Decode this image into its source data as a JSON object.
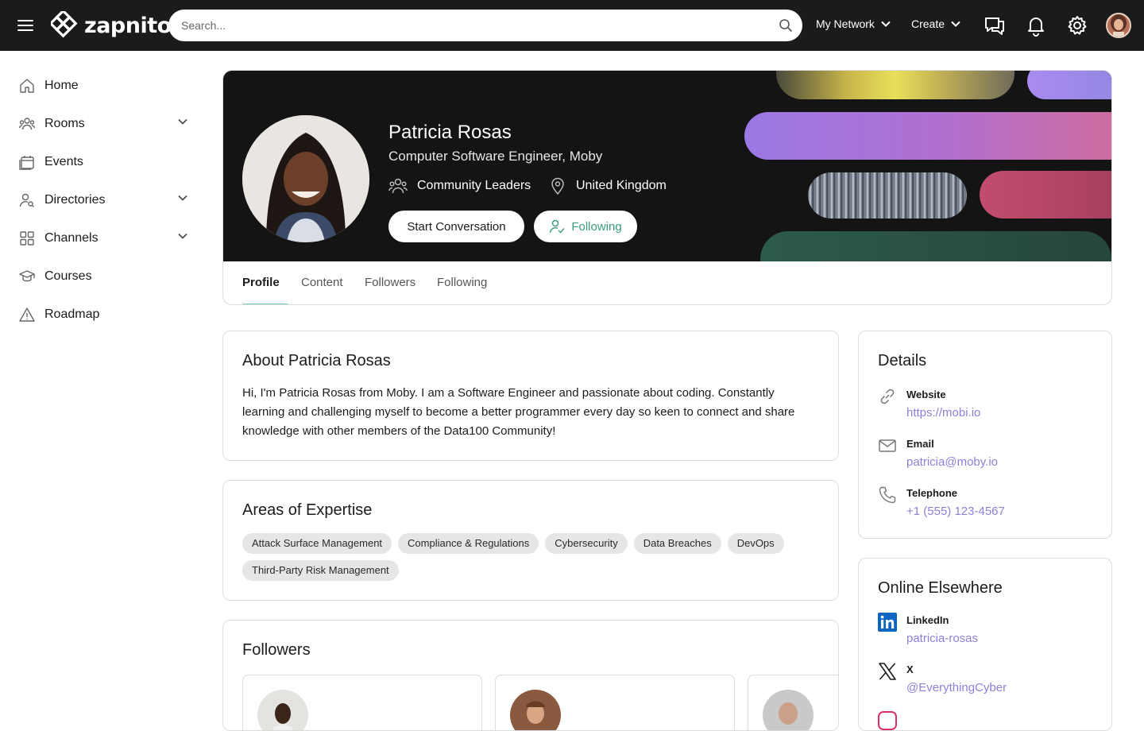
{
  "header": {
    "logo_text": "zapnito",
    "search_placeholder": "Search...",
    "nav": [
      {
        "label": "My Network"
      },
      {
        "label": "Create"
      }
    ],
    "icons": [
      "menu-icon",
      "chat-icon",
      "bell-icon",
      "gear-icon"
    ]
  },
  "sidebar": {
    "items": [
      {
        "label": "Home",
        "icon": "home-icon",
        "expandable": false
      },
      {
        "label": "Rooms",
        "icon": "users-icon",
        "expandable": true
      },
      {
        "label": "Events",
        "icon": "calendar-icon",
        "expandable": false
      },
      {
        "label": "Directories",
        "icon": "people-search-icon",
        "expandable": true
      },
      {
        "label": "Channels",
        "icon": "grid-icon",
        "expandable": true
      },
      {
        "label": "Courses",
        "icon": "graduation-cap-icon",
        "expandable": false
      },
      {
        "label": "Roadmap",
        "icon": "warning-icon",
        "expandable": false
      }
    ]
  },
  "profile": {
    "name": "Patricia Rosas",
    "title": "Computer Software Engineer, Moby",
    "group": "Community Leaders",
    "location": "United Kingdom",
    "start_conversation": "Start Conversation",
    "following": "Following"
  },
  "tabs": [
    {
      "label": "Profile",
      "active": true
    },
    {
      "label": "Content",
      "active": false
    },
    {
      "label": "Followers",
      "active": false
    },
    {
      "label": "Following",
      "active": false
    }
  ],
  "about": {
    "title": "About Patricia Rosas",
    "text": "Hi, I'm Patricia Rosas from Moby. I am a Software Engineer and passionate about coding. Constantly learning and challenging myself to become a better programmer every day so keen to connect and share knowledge with other members of the Data100 Community!"
  },
  "expertise": {
    "title": "Areas of Expertise",
    "tags": [
      "Attack Surface Management",
      "Compliance & Regulations",
      "Cybersecurity",
      "Data Breaches",
      "DevOps",
      "Third-Party Risk Management"
    ]
  },
  "followers": {
    "title": "Followers"
  },
  "details": {
    "title": "Details",
    "rows": [
      {
        "label": "Website",
        "value": "https://mobi.io",
        "icon": "link-icon"
      },
      {
        "label": "Email",
        "value": "patricia@moby.io",
        "icon": "mail-icon"
      },
      {
        "label": "Telephone",
        "value": "+1 (555) 123-4567",
        "icon": "phone-icon"
      }
    ]
  },
  "elsewhere": {
    "title": "Online Elsewhere",
    "rows": [
      {
        "label": "LinkedIn",
        "value": "patricia-rosas",
        "icon": "linkedin-icon"
      },
      {
        "label": "X",
        "value": "@EverythingCyber",
        "icon": "x-icon"
      }
    ]
  },
  "colors": {
    "topbar": "#1b1b1b",
    "accent_link": "#8b82d6",
    "following_text": "#3a9b7e",
    "tab_underline": "#7bd0b4"
  }
}
